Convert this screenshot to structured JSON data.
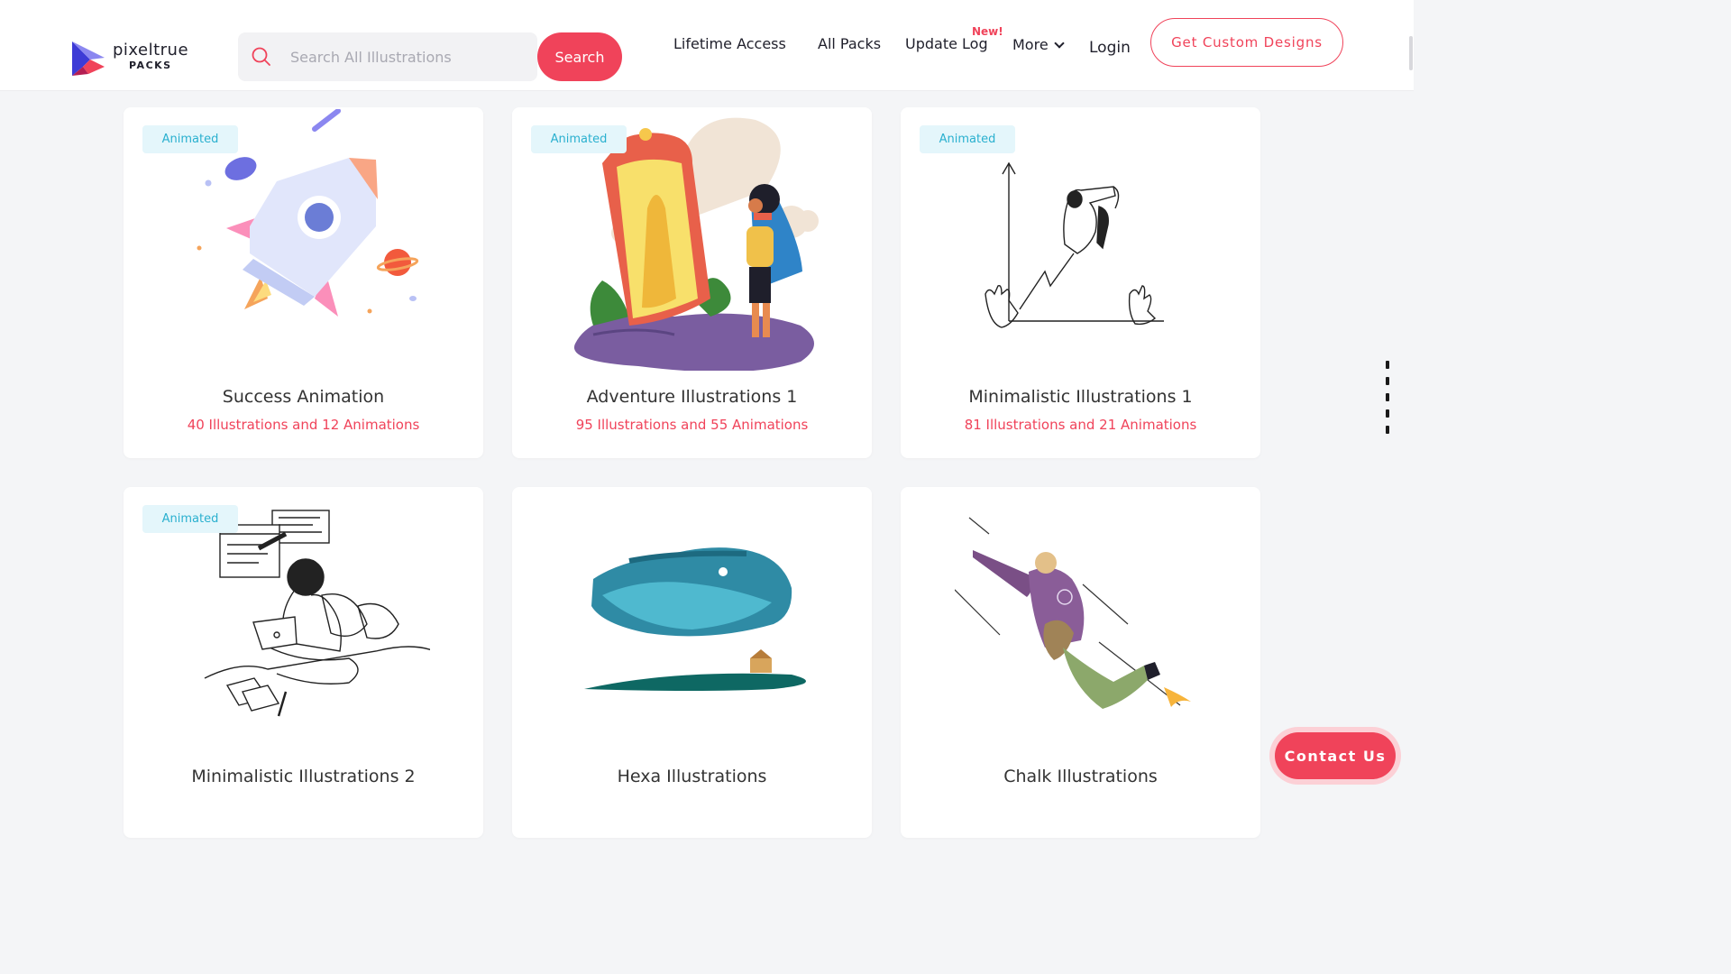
{
  "brand": {
    "name": "pixeltrue",
    "sub": "PACKS"
  },
  "search": {
    "placeholder": "Search All Illustrations",
    "value": "",
    "button_label": "Search"
  },
  "nav": {
    "lifetime": "Lifetime Access",
    "all_packs": "All Packs",
    "update_log": "Update Log",
    "new_badge": "New!",
    "more": "More",
    "login": "Login",
    "custom": "Get Custom Designs"
  },
  "cards": [
    {
      "badge": "Animated",
      "title": "Success Animation",
      "subtitle": "40 Illustrations and 12 Animations",
      "art": "rocket-illustration"
    },
    {
      "badge": "Animated",
      "title": "Adventure Illustrations 1",
      "subtitle": "95 Illustrations and 55 Animations",
      "art": "mirror-hero-illustration"
    },
    {
      "badge": "Animated",
      "title": "Minimalistic Illustrations 1",
      "subtitle": "81 Illustrations and 21 Animations",
      "art": "growth-chart-illustration"
    },
    {
      "badge": "Animated",
      "title": "Minimalistic Illustrations 2",
      "subtitle": "",
      "art": "laptop-woman-illustration"
    },
    {
      "badge": "",
      "title": "Hexa Illustrations",
      "subtitle": "",
      "art": "floating-island-illustration"
    },
    {
      "badge": "",
      "title": "Chalk Illustrations",
      "subtitle": "",
      "art": "flying-man-illustration"
    }
  ],
  "contact": {
    "label": "Contact Us"
  },
  "colors": {
    "accent": "#f0435a",
    "badge_text": "#2ab0cf",
    "badge_bg": "#e4f6fb",
    "background": "#f4f5f7"
  }
}
